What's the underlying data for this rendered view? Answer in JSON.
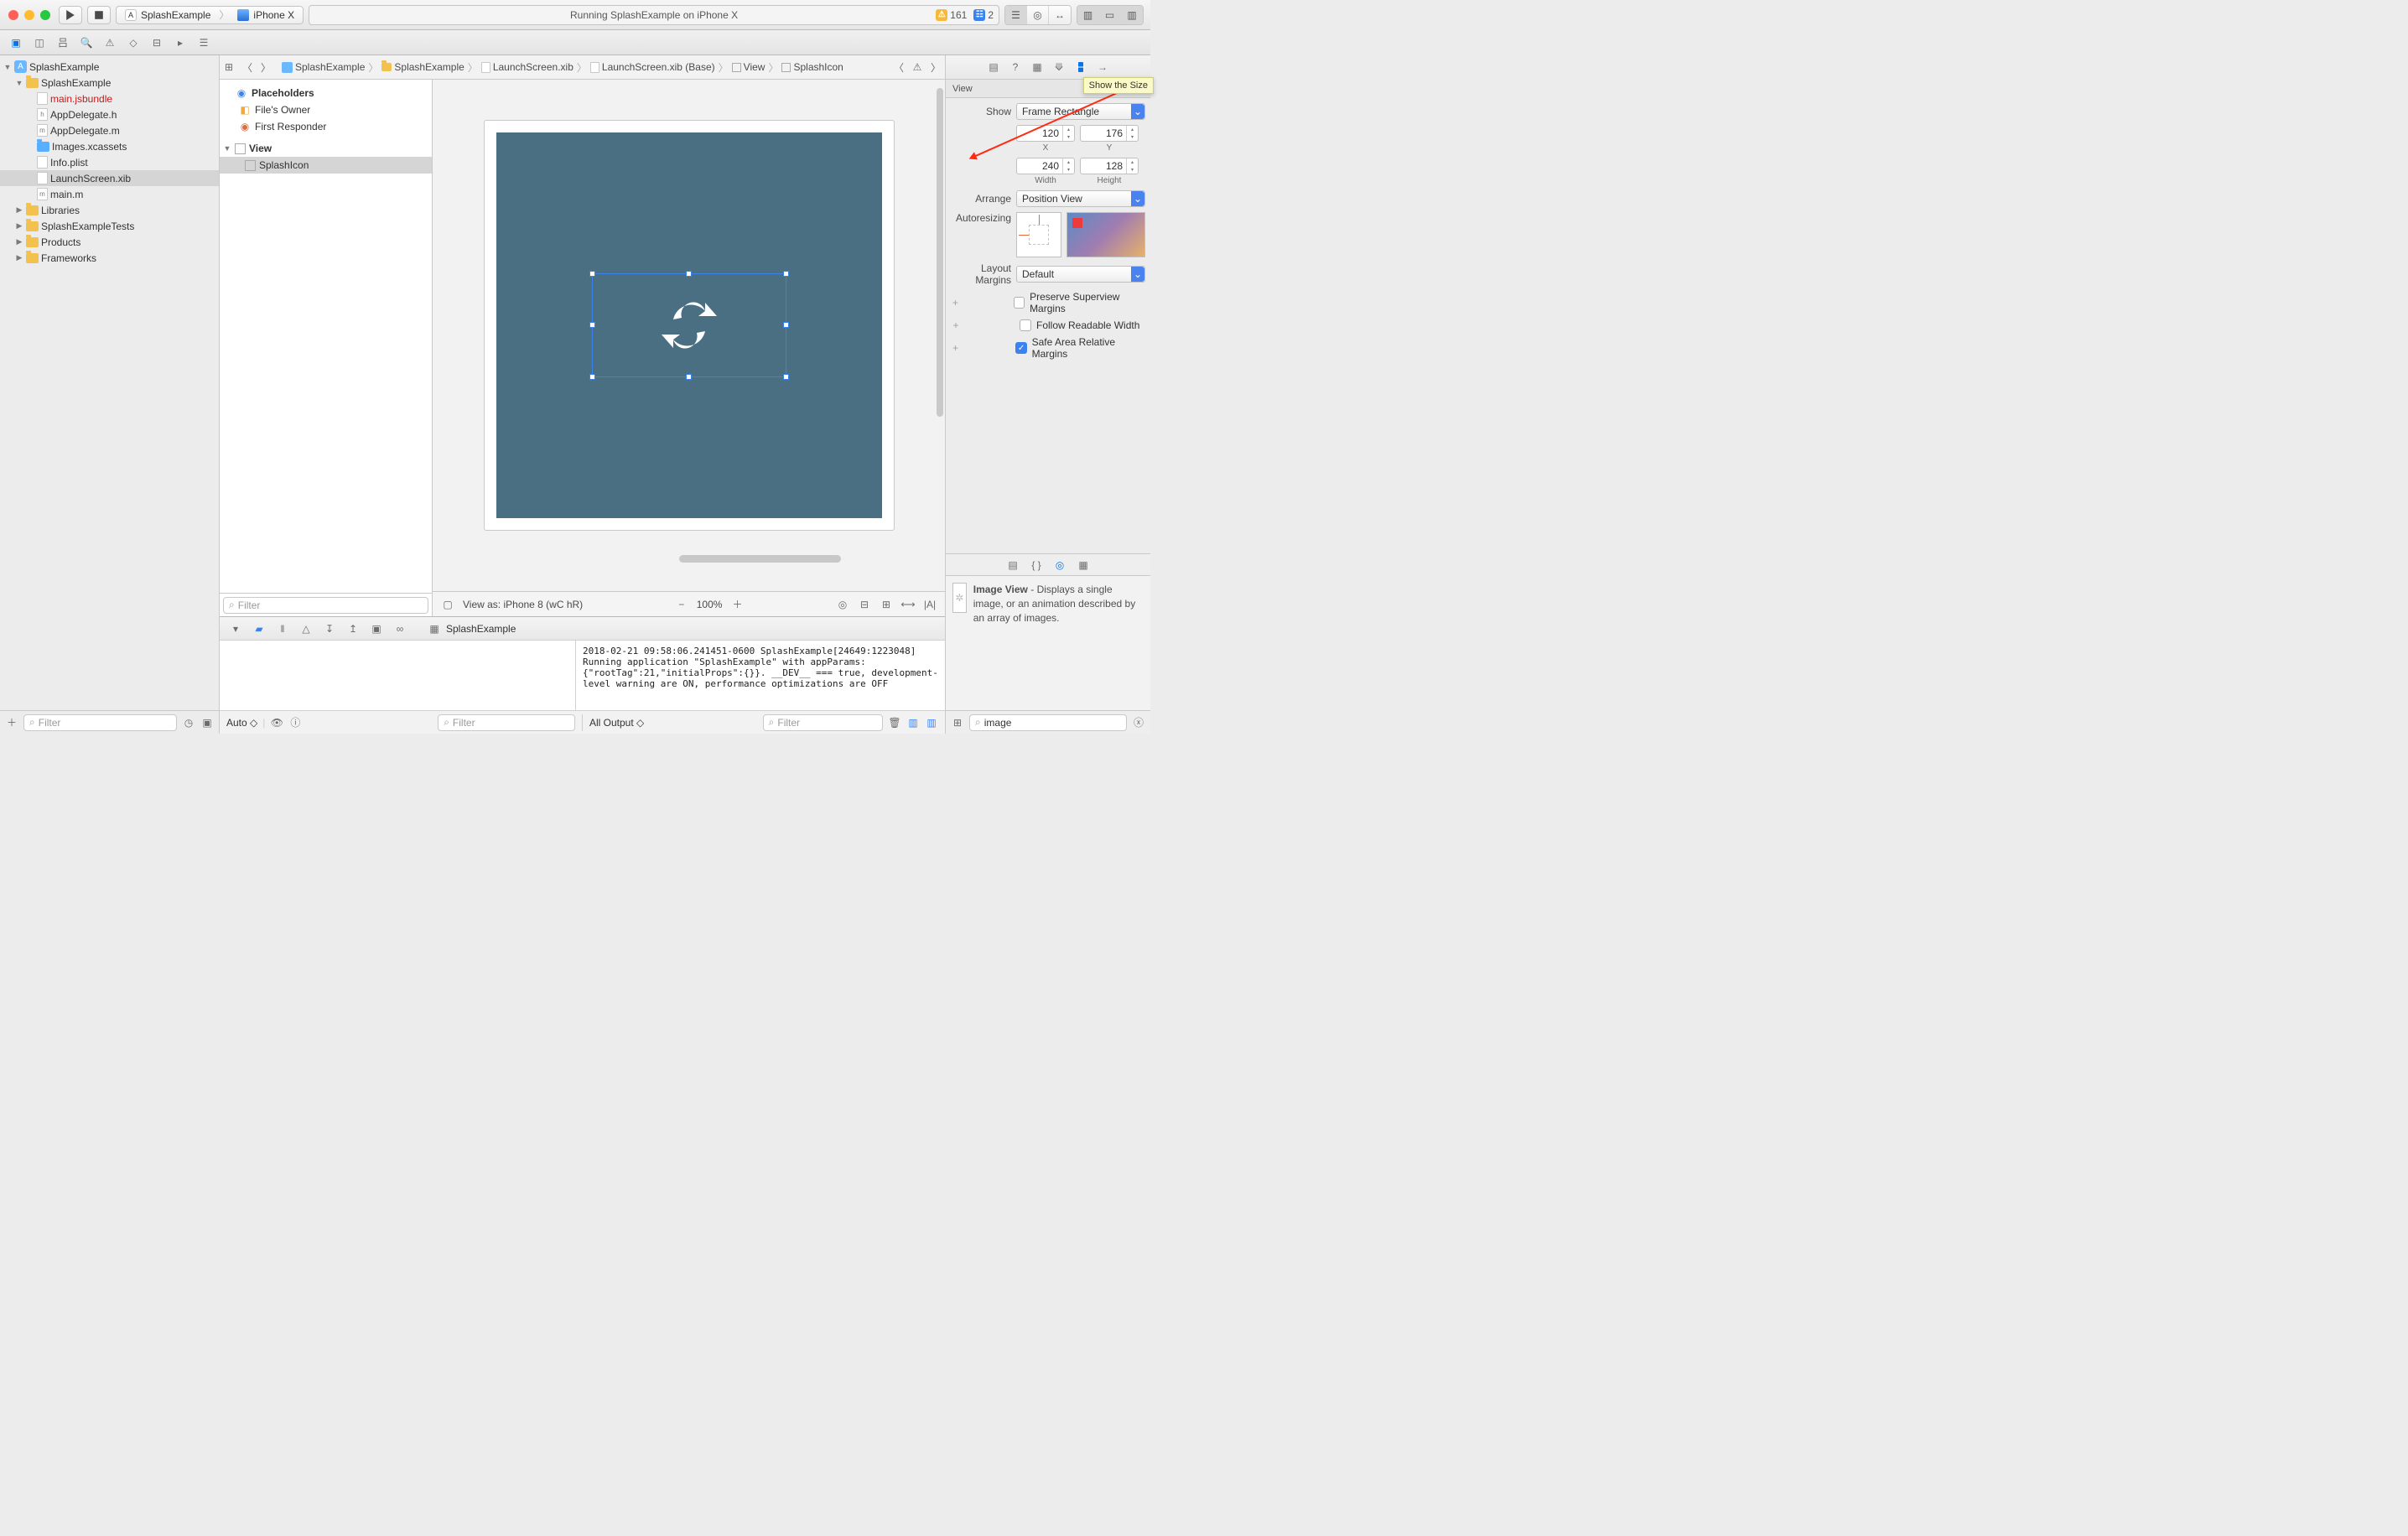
{
  "toolbar": {
    "scheme_app": "SplashExample",
    "scheme_dest": "iPhone X",
    "status_text": "Running SplashExample on iPhone X",
    "warn_count": "161",
    "info_count": "2"
  },
  "project_tree": {
    "root": "SplashExample",
    "group": "SplashExample",
    "files": [
      "main.jsbundle",
      "AppDelegate.h",
      "AppDelegate.m",
      "Images.xcassets",
      "Info.plist",
      "LaunchScreen.xib",
      "main.m"
    ],
    "folders": [
      "Libraries",
      "SplashExampleTests",
      "Products",
      "Frameworks"
    ]
  },
  "outline": {
    "section": "Placeholders",
    "owner": "File's Owner",
    "responder": "First Responder",
    "view": "View",
    "splash": "SplashIcon"
  },
  "crumbs": [
    "SplashExample",
    "SplashExample",
    "LaunchScreen.xib",
    "LaunchScreen.xib (Base)",
    "View",
    "SplashIcon"
  ],
  "viewbar": {
    "label": "View as: iPhone 8 (wC hR)",
    "zoom": "100%"
  },
  "debug": {
    "target": "SplashExample",
    "console": "2018-02-21 09:58:06.241451-0600 SplashExample[24649:1223048] Running application \"SplashExample\" with appParams: {\"rootTag\":21,\"initialProps\":{}}. __DEV__ === true, development-level warning are ON, performance optimizations are OFF",
    "auto": "Auto ◇",
    "all_output": "All Output ◇"
  },
  "inspector": {
    "heading": "View",
    "tooltip": "Show the Size",
    "show_label": "Show",
    "show_value": "Frame Rectangle",
    "x": "120",
    "y": "176",
    "w": "240",
    "h": "128",
    "xl": "X",
    "yl": "Y",
    "wl": "Width",
    "hl": "Height",
    "arrange_label": "Arrange",
    "arrange_value": "Position View",
    "autoresize_label": "Autoresizing",
    "margins_label": "Layout Margins",
    "margins_value": "Default",
    "chk1": "Preserve Superview Margins",
    "chk2": "Follow Readable Width",
    "chk3": "Safe Area Relative Margins"
  },
  "library": {
    "title": "Image View",
    "desc": " - Displays a single image, or an animation described by an array of images.",
    "filter": "image"
  },
  "filters": {
    "nav": "Filter",
    "outline": "Filter",
    "vars": "Filter",
    "cons": "Filter"
  }
}
